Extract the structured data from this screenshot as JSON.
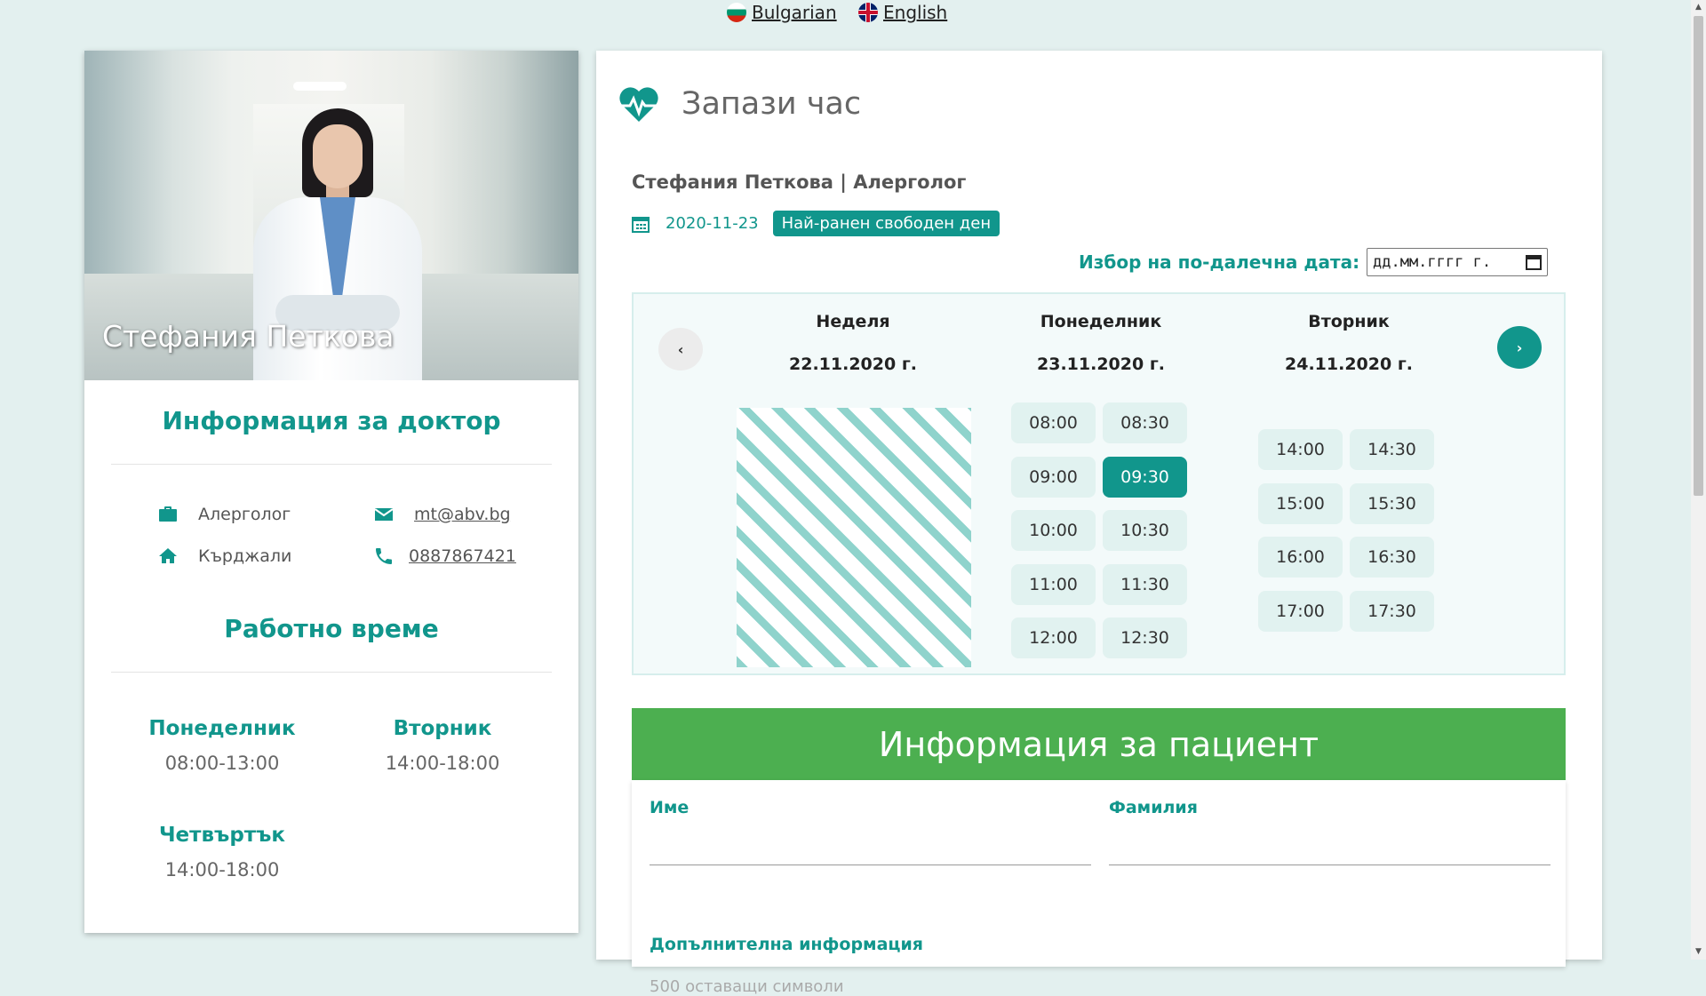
{
  "languages": [
    {
      "label": "Bulgarian",
      "icon": "bulgarian-flag-icon"
    },
    {
      "label": "English",
      "icon": "uk-flag-icon"
    }
  ],
  "doctor": {
    "photo_name": "Стефания Петкова",
    "info_title": "Информация за доктор",
    "specialty": "Алерголог",
    "email": "mt@abv.bg",
    "city": "Кърджали",
    "phone": "0887867421"
  },
  "work_time": {
    "title": "Работно време",
    "days": [
      {
        "name": "Понеделник",
        "hours": "08:00-13:00"
      },
      {
        "name": "Вторник",
        "hours": "14:00-18:00"
      },
      {
        "name": "Четвъртък",
        "hours": "14:00-18:00"
      }
    ]
  },
  "booking": {
    "title": "Запази час",
    "doctor_line": "Стефания Петкова | Алерголог",
    "earliest_date": "2020-11-23",
    "earliest_badge": "Най-ранен свободен ден",
    "further_date_label": "Избор на по-далечна дата:",
    "date_placeholder": "дд.мм.гггг г.",
    "prev_button": "‹",
    "next_button": "›",
    "columns": [
      {
        "weekday": "Неделя",
        "date": "22.11.2020 г.",
        "slots": []
      },
      {
        "weekday": "Понеделник",
        "date": "23.11.2020 г.",
        "slots": [
          "08:00",
          "08:30",
          "09:00",
          "09:30",
          "10:00",
          "10:30",
          "11:00",
          "11:30",
          "12:00",
          "12:30"
        ]
      },
      {
        "weekday": "Вторник",
        "date": "24.11.2020 г.",
        "slots": [
          "14:00",
          "14:30",
          "15:00",
          "15:30",
          "16:00",
          "16:30",
          "17:00",
          "17:30"
        ]
      }
    ],
    "selected_slot": "09:30"
  },
  "patient": {
    "title": "Информация за пациент",
    "first_name_label": "Име",
    "last_name_label": "Фамилия",
    "extra_label": "Допълнителна информация",
    "chars_left": "500 оставащи символи"
  },
  "colors": {
    "accent": "#11968c",
    "patient_header": "#4caf50",
    "background": "#e3f0ef"
  }
}
